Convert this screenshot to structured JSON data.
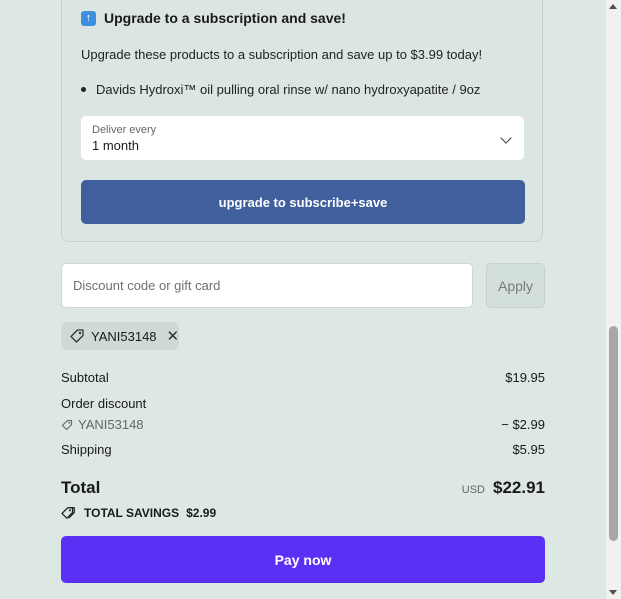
{
  "upsell": {
    "title": "Upgrade to a subscription and save!",
    "description": "Upgrade these products to a subscription and save up to $3.99 today!",
    "product": "Davids Hydroxi™ oil pulling oral rinse w/ nano hydroxyapatite / 9oz",
    "deliver_label": "Deliver every",
    "deliver_value": "1 month",
    "upgrade_button": "upgrade to subscribe+save"
  },
  "discount": {
    "placeholder": "Discount code or gift card",
    "apply_label": "Apply",
    "applied_code": "YANI53148"
  },
  "summary": {
    "subtotal_label": "Subtotal",
    "subtotal_value": "$19.95",
    "order_discount_label": "Order discount",
    "discount_code": "YANI53148",
    "discount_value": "− $2.99",
    "shipping_label": "Shipping",
    "shipping_value": "$5.95",
    "total_label": "Total",
    "currency": "USD",
    "total_value": "$22.91",
    "savings_label": "TOTAL SAVINGS",
    "savings_value": "$2.99"
  },
  "pay_button": "Pay now",
  "colors": {
    "background": "#dde7e3",
    "upgrade_button": "#3f5f9d",
    "pay_button": "#5a31f4"
  }
}
